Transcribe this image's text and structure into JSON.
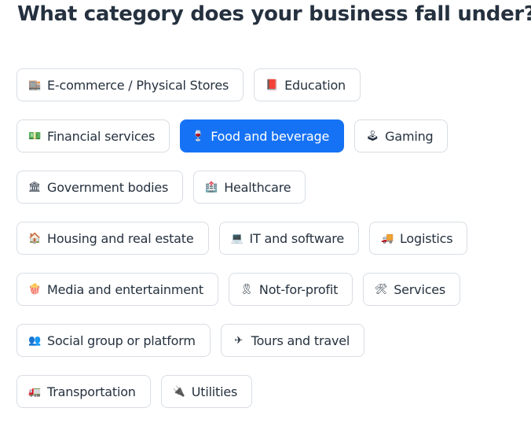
{
  "page": {
    "title": "What category does your business fall under?"
  },
  "colors": {
    "selected_bg": "#1672f4",
    "chip_border": "#d8dde3",
    "text": "#25313f"
  },
  "rows": [
    [
      {
        "label": "E-commerce / Physical Stores",
        "icon": "🏬",
        "icon_name": "store-icon",
        "selected": false
      },
      {
        "label": "Education",
        "icon": "📕",
        "icon_name": "book-icon",
        "selected": false
      }
    ],
    [
      {
        "label": "Financial services",
        "icon": "💵",
        "icon_name": "money-icon",
        "selected": false
      },
      {
        "label": "Food and beverage",
        "icon": "🍷",
        "icon_name": "wine-glass-icon",
        "selected": true
      },
      {
        "label": "Gaming",
        "icon": "🕹",
        "icon_name": "joystick-icon",
        "selected": false
      }
    ],
    [
      {
        "label": "Government bodies",
        "icon": "🏛",
        "icon_name": "government-building-icon",
        "selected": false
      },
      {
        "label": "Healthcare",
        "icon": "🏥",
        "icon_name": "hospital-icon",
        "selected": false
      }
    ],
    [
      {
        "label": "Housing and real estate",
        "icon": "🏠",
        "icon_name": "house-icon",
        "selected": false
      },
      {
        "label": "IT and software",
        "icon": "💻",
        "icon_name": "laptop-icon",
        "selected": false
      },
      {
        "label": "Logistics",
        "icon": "🚚",
        "icon_name": "truck-icon",
        "selected": false
      }
    ],
    [
      {
        "label": "Media and entertainment",
        "icon": "🍿",
        "icon_name": "popcorn-icon",
        "selected": false
      },
      {
        "label": "Not-for-profit",
        "icon": "🎗",
        "icon_name": "ribbon-icon",
        "selected": false
      },
      {
        "label": "Services",
        "icon": "🛠",
        "icon_name": "tools-icon",
        "selected": false
      }
    ],
    [
      {
        "label": "Social group or platform",
        "icon": "👥",
        "icon_name": "people-icon",
        "selected": false
      },
      {
        "label": "Tours and travel",
        "icon": "✈",
        "icon_name": "airplane-icon",
        "selected": false
      }
    ],
    [
      {
        "label": "Transportation",
        "icon": "🚛",
        "icon_name": "transport-truck-icon",
        "selected": false
      },
      {
        "label": "Utilities",
        "icon": "🔌",
        "icon_name": "plug-icon",
        "selected": false
      }
    ]
  ]
}
